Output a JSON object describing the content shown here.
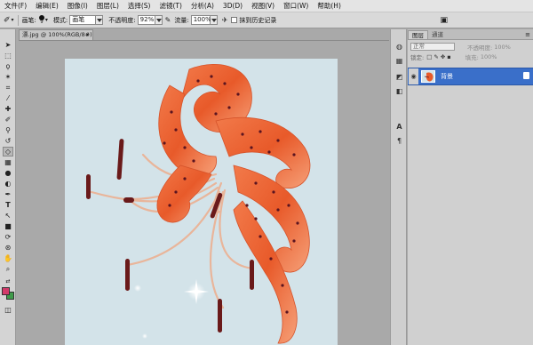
{
  "menu": [
    "文件(F)",
    "编辑(E)",
    "图像(I)",
    "图层(L)",
    "选择(S)",
    "滤镜(T)",
    "分析(A)",
    "3D(D)",
    "视图(V)",
    "窗口(W)",
    "帮助(H)"
  ],
  "options": {
    "brush_label": "画笔:",
    "brush_size": "9",
    "mode_label": "模式:",
    "mode_value": "画笔",
    "opacity_label": "不透明度:",
    "opacity_value": "92%",
    "flow_label": "流量:",
    "flow_value": "100%",
    "history_label": "抹到历史记录"
  },
  "document": {
    "tab_title": "漂.jpg @ 100%(RGB/8#)"
  },
  "layers_panel": {
    "tabs": [
      "图层",
      "通道"
    ],
    "blend_mode": "正常",
    "opacity_label": "不透明度:",
    "opacity_value": "100%",
    "lock_label": "锁定:",
    "fill_label": "填充:",
    "fill_value": "100%",
    "layer_name": "背景"
  },
  "colors": {
    "foreground": "#d33a6a",
    "background": "#3f9a4a",
    "selection": "#3a6fc9",
    "canvas_bg": "#d3e3e9"
  },
  "tool_icons": [
    "move-icon",
    "marquee-icon",
    "lasso-icon",
    "magic-wand-icon",
    "crop-icon",
    "eyedropper-icon",
    "healing-icon",
    "brush-icon",
    "clone-stamp-icon",
    "history-brush-icon",
    "eraser-icon",
    "gradient-icon",
    "blur-icon",
    "dodge-icon",
    "pen-icon",
    "type-icon",
    "path-select-icon",
    "shape-icon",
    "3d-rotate-icon",
    "3d-camera-icon",
    "hand-icon",
    "zoom-icon"
  ]
}
